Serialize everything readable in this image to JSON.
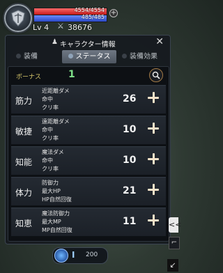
{
  "hud": {
    "hp_text": "4554/4554",
    "mp_text": "485/485",
    "hp_fill": 1.0,
    "mp_fill": 1.0,
    "level": "Lv 4",
    "combat_power": "38676",
    "colors": {
      "hp": "#d42424",
      "mp": "#3452d1"
    }
  },
  "panel": {
    "title": "キャラクター情報",
    "close_label": "✕",
    "tabs": [
      {
        "label": "装備"
      },
      {
        "label": "ステータス",
        "selected": true
      },
      {
        "label": "装備効果"
      }
    ],
    "bonus_label": "ボーナス",
    "bonus_value": "1",
    "stats": [
      {
        "name": "筋力",
        "subs": [
          "近距離ダメ",
          "命中",
          "クリ率"
        ],
        "value": "26"
      },
      {
        "name": "敏捷",
        "subs": [
          "遠距離ダメ",
          "命中",
          "クリ率"
        ],
        "value": "10"
      },
      {
        "name": "知能",
        "subs": [
          "魔法ダメ",
          "命中",
          "クリ率"
        ],
        "value": "10"
      },
      {
        "name": "体力",
        "subs": [
          "防御力",
          "最大HP",
          "HP自然回復"
        ],
        "value": "21"
      },
      {
        "name": "知恵",
        "subs": [
          "魔法防御力",
          "最大MP",
          "MP自然回復"
        ],
        "value": "11"
      }
    ]
  },
  "bottom": {
    "roman": "I",
    "value": "200"
  },
  "side_buttons": [
    "<<",
    "⌐",
    "↙"
  ]
}
